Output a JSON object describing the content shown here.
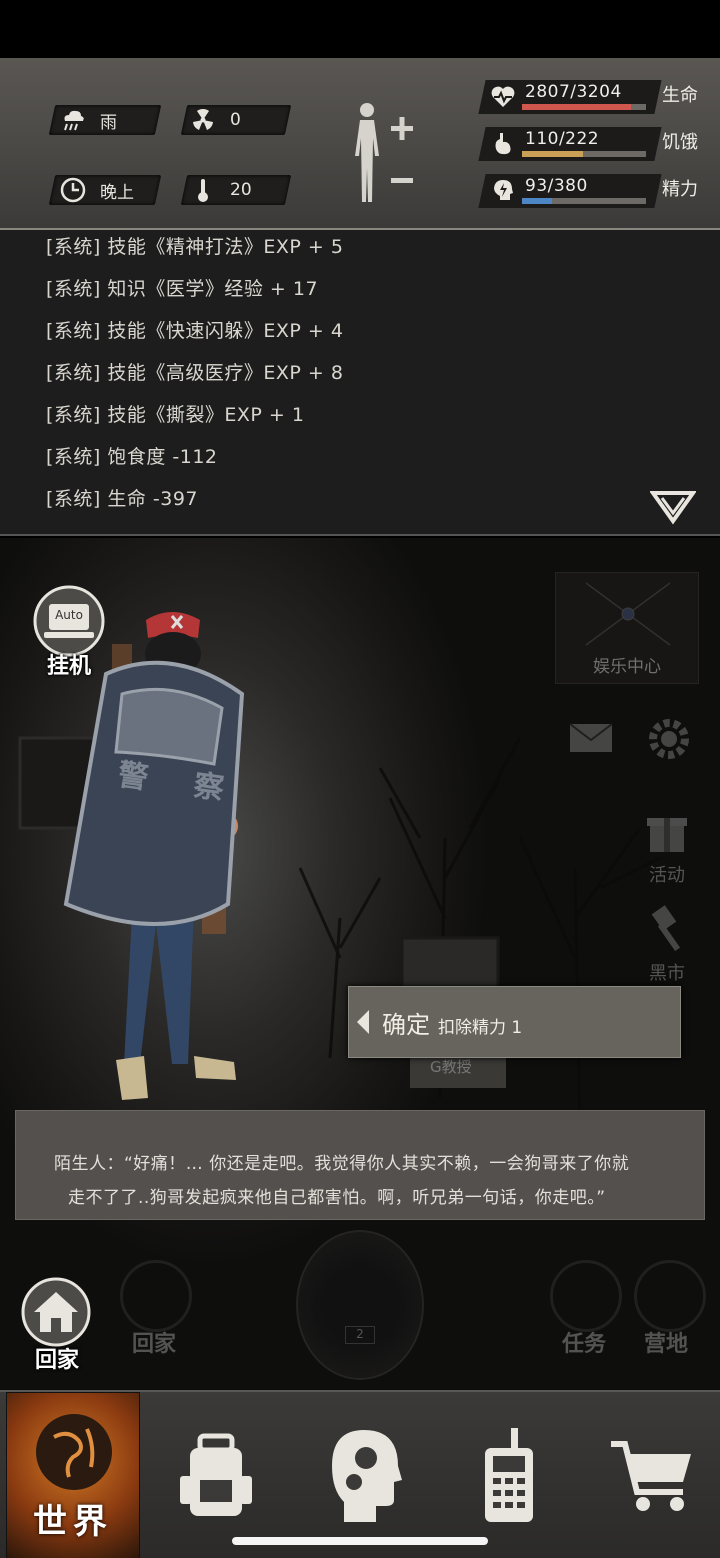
{
  "hud": {
    "weather": "雨",
    "radiation": "0",
    "time_of_day": "晚上",
    "temperature": "20",
    "health": {
      "value": "2807/3204",
      "label": "生命",
      "fraction": 0.876,
      "color": "#d0574e"
    },
    "hunger": {
      "value": "110/222",
      "label": "饥饿",
      "fraction": 0.495,
      "color": "#c9a055"
    },
    "energy": {
      "value": "93/380",
      "label": "精力",
      "fraction": 0.245,
      "color": "#4e86c5"
    }
  },
  "log": {
    "lines": [
      "[系统] 技能《精神打法》EXP + 5",
      "[系统] 知识《医学》经验 + 17",
      "[系统] 技能《快速闪躲》EXP + 4",
      "[系统] 技能《高级医疗》EXP + 8",
      "[系统] 技能《撕裂》EXP + 1",
      "[系统] 饱食度 -112",
      "[系统] 生命 -397"
    ]
  },
  "scene": {
    "auto_label": "挂机",
    "auto_badge": "Auto",
    "entertainment": "娱乐中心",
    "activity": "活动",
    "black_market": "黑市",
    "shield_text": "警 察",
    "confirm_main": "确定",
    "confirm_sub": "扣除精力 1",
    "dialog_line1": "陌生人：“好痛！… 你还是走吧。我觉得你人其实不赖，一会狗哥来了你就",
    "dialog_line2": "走不了了..狗哥发起疯来他自己都害怕。啊，听兄弟一句话，你走吧。”",
    "home_label": "回家",
    "ghost_home": "回家",
    "ghost_task": "任务",
    "ghost_camp": "营地",
    "sign_text": "G教授",
    "page_num": "2"
  },
  "nav": {
    "world": "世界"
  }
}
